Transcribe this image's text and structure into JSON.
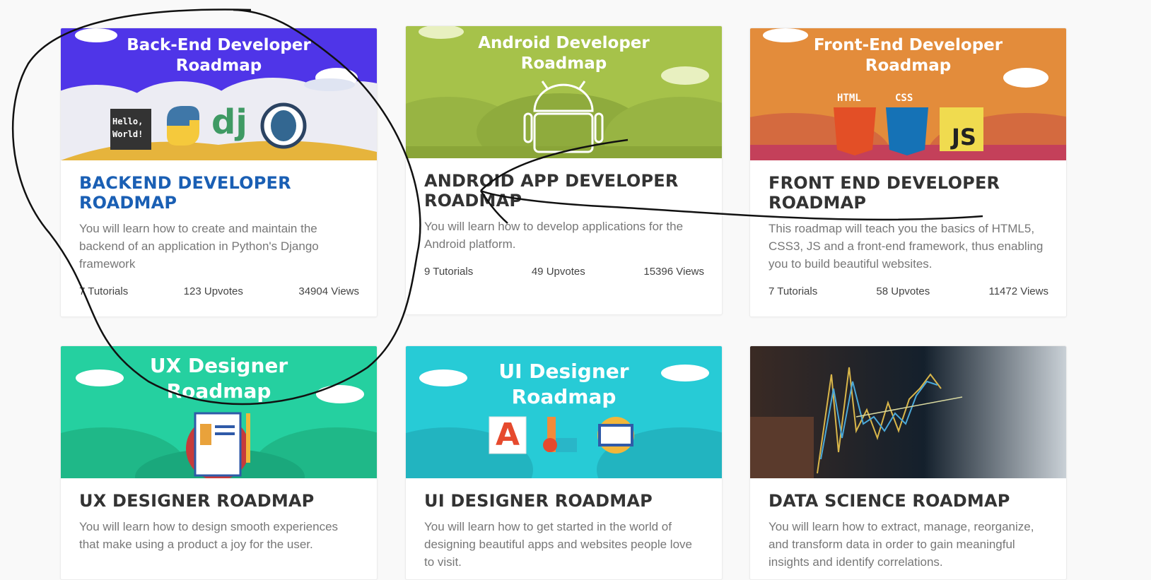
{
  "cards": [
    {
      "banner_title": "Back-End Developer\nRoadmap",
      "banner_color": "#4f35e8",
      "hello_text": "Hello,\nWorld!",
      "dj_text": "dj",
      "title": "BACKEND DEVELOPER ROADMAP",
      "description": "You will learn how to create and maintain the backend of an application in Python's Django framework",
      "tutorials": "7 Tutorials",
      "upvotes": "123 Upvotes",
      "views": "34904 Views"
    },
    {
      "banner_title": "Android Developer\nRoadmap",
      "banner_color": "#a6c24a",
      "title": "ANDROID APP DEVELOPER ROADMAP",
      "description": "You will learn how to develop applications for the Android platform.",
      "tutorials": "9 Tutorials",
      "upvotes": "49 Upvotes",
      "views": "15396 Views"
    },
    {
      "banner_title": "Front-End Developer\nRoadmap",
      "banner_color": "#e38c3b",
      "html_label": "HTML",
      "css_label": "CSS",
      "js_label": "JS",
      "title": "FRONT END DEVELOPER ROADMAP",
      "description": "This roadmap will teach you the basics of HTML5, CSS3, JS and a front-end framework, thus enabling you to build beautiful websites.",
      "tutorials": "7 Tutorials",
      "upvotes": "58 Upvotes",
      "views": "11472 Views"
    },
    {
      "banner_title": "UX Designer\nRoadmap",
      "banner_color": "#25d0a0",
      "title": "UX DESIGNER ROADMAP",
      "description": "You will learn how to design smooth experiences that make using a product a joy for the user."
    },
    {
      "banner_title": "UI Designer\nRoadmap",
      "banner_color": "#27cbd6",
      "a_label": "A",
      "title": "UI DESIGNER ROADMAP",
      "description": "You will learn how to get started in the world of designing beautiful apps and websites people love to visit."
    },
    {
      "banner_color": "#1c2a38",
      "title": "DATA SCIENCE ROADMAP",
      "description": "You will learn how to extract, manage, reorganize, and transform data in order to gain meaningful insights and identify correlations."
    }
  ]
}
